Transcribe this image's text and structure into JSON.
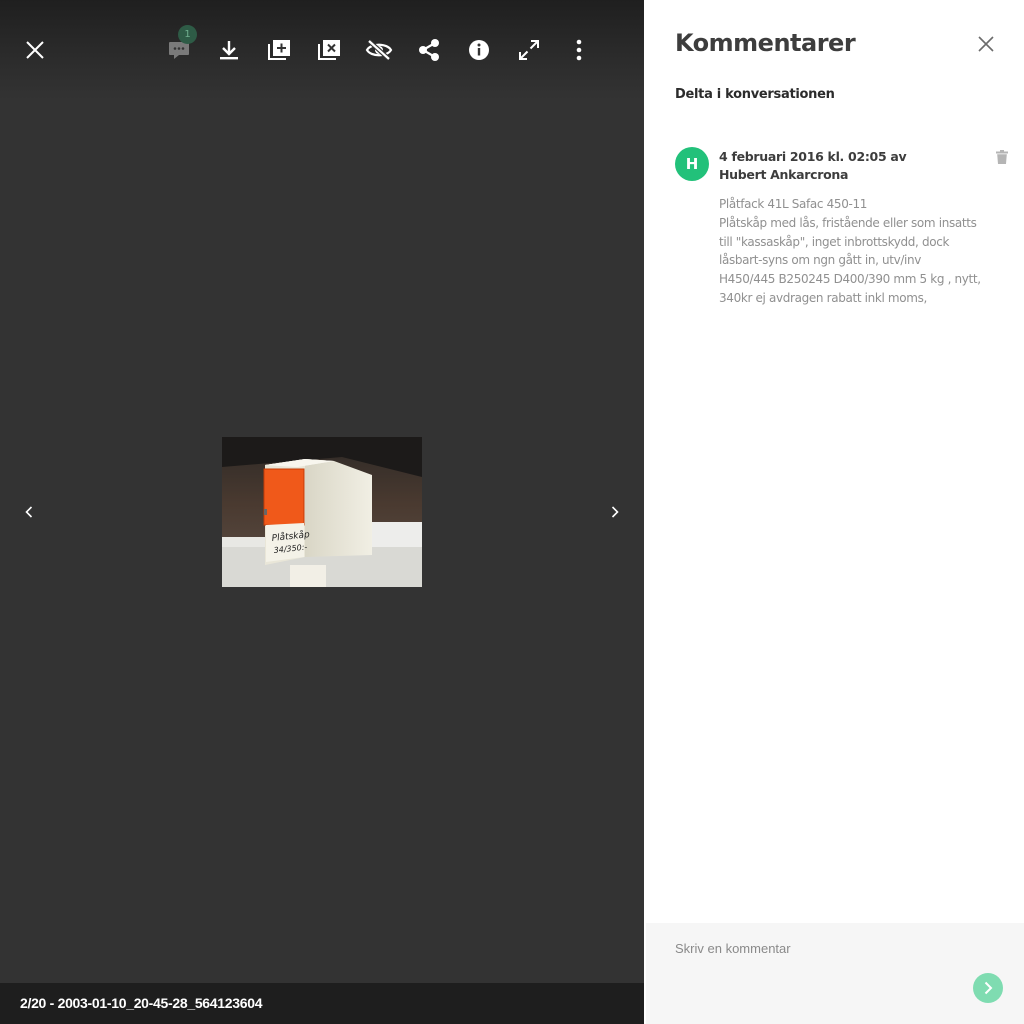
{
  "viewer": {
    "toolbar": {
      "close": {
        "icon": "close-icon"
      },
      "comments": {
        "icon": "comment-icon",
        "badge_count": "1"
      },
      "download": {
        "icon": "download-icon"
      },
      "add_to_album": {
        "icon": "add-to-album-icon"
      },
      "remove_from_album": {
        "icon": "remove-from-album-icon"
      },
      "hide": {
        "icon": "eye-off-icon"
      },
      "share": {
        "icon": "share-icon"
      },
      "info": {
        "icon": "info-icon"
      },
      "fullscreen": {
        "icon": "fullscreen-icon"
      },
      "more": {
        "icon": "more-vertical-icon"
      }
    },
    "nav": {
      "prev_icon": "chevron-left-icon",
      "next_icon": "chevron-right-icon"
    },
    "photo": {
      "handwritten_label": "Plåtskåp 34/350:-"
    },
    "filename": "2/20 - 2003-01-10_20-45-28_564123604"
  },
  "sidebar": {
    "title": "Kommentarer",
    "subtitle": "Delta i konversationen",
    "comments": [
      {
        "avatar_letter": "H",
        "avatar_color": "#22c17a",
        "meta": "4 februari 2016 kl. 02:05 av Hubert Ankarcrona",
        "body_lines": [
          "Plåtfack 41L Safac 450-11",
          "Plåtskåp med lås, fristående eller som insatts",
          "till \"kassaskåp\", inget inbrottskydd, dock",
          "låsbart-syns om ngn gått in, utv/inv",
          "H450/445 B250245 D400/390 mm 5 kg , nytt,",
          "340kr ej avdragen rabatt inkl moms,"
        ]
      }
    ],
    "composer": {
      "placeholder": "Skriv en kommentar"
    }
  },
  "colors": {
    "viewer_bg": "#333333",
    "accent_green": "#22c17a",
    "send_button": "#7fdcb1"
  }
}
